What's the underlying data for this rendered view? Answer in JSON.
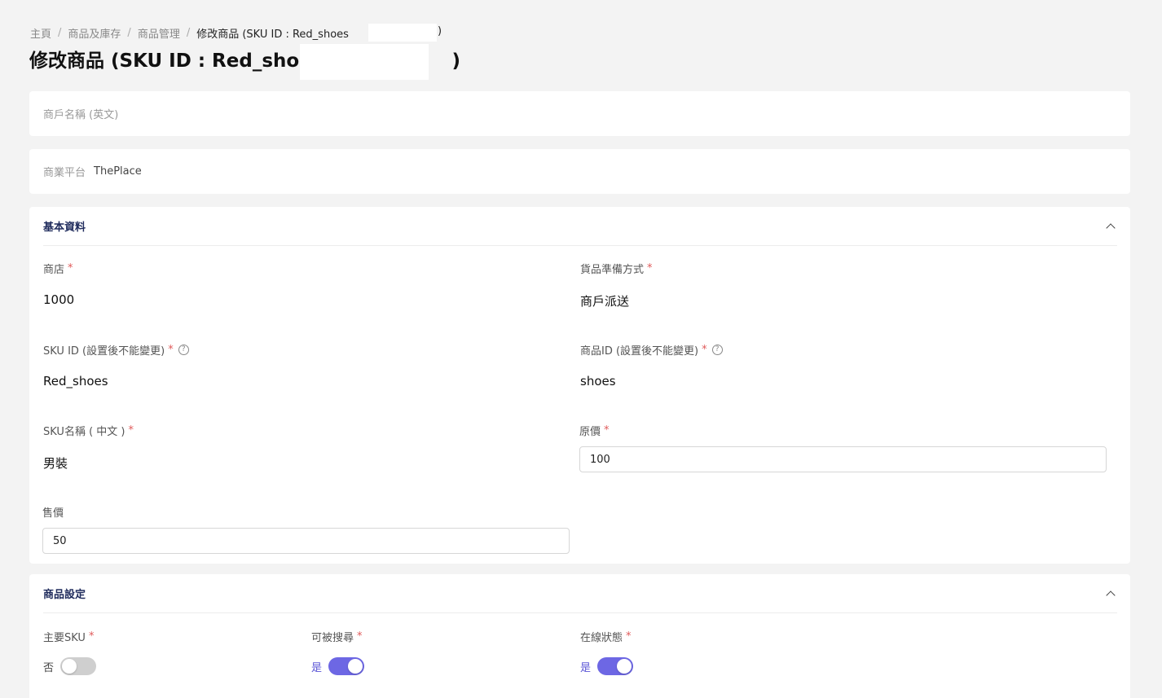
{
  "breadcrumb": {
    "home": "主頁",
    "products_inventory": "商品及庫存",
    "product_management": "商品管理",
    "current": "修改商品 (SKU ID : Red_shoes",
    "current_close": ")"
  },
  "page_title": "修改商品 (SKU ID : Red_shoes",
  "page_title_close": ")",
  "merchant_name_label": "商戶名稱 (英文)",
  "platform": {
    "label": "商業平台",
    "value": "ThePlace"
  },
  "basic_info": {
    "title": "基本資料",
    "store": {
      "label": "商店",
      "value": "1000"
    },
    "fulfillment": {
      "label": "貨品準備方式",
      "value": "商戶派送"
    },
    "sku_id": {
      "label": "SKU ID (設置後不能變更)",
      "value": "Red_shoes"
    },
    "product_id": {
      "label": "商品ID (設置後不能變更)",
      "value": "shoes"
    },
    "sku_name": {
      "label": "SKU名稱 ( 中文 )",
      "value": "男裝"
    },
    "original_price": {
      "label": "原價",
      "value": "100"
    },
    "sale_price": {
      "label": "售價",
      "value": "50"
    }
  },
  "product_settings": {
    "title": "商品設定",
    "main_sku": {
      "label": "主要SKU",
      "state_text": "否",
      "on": false
    },
    "searchable": {
      "label": "可被搜尋",
      "state_text": "是",
      "on": true
    },
    "online_status": {
      "label": "在線狀態",
      "state_text": "是",
      "on": true
    }
  },
  "required_mark": "*",
  "help_glyph": "?",
  "colors": {
    "accent": "#6d67e4",
    "required": "#e05a5a",
    "section_title": "#1f2b5c"
  },
  "icons": [
    "help-circle-icon",
    "chevron-up-icon"
  ]
}
